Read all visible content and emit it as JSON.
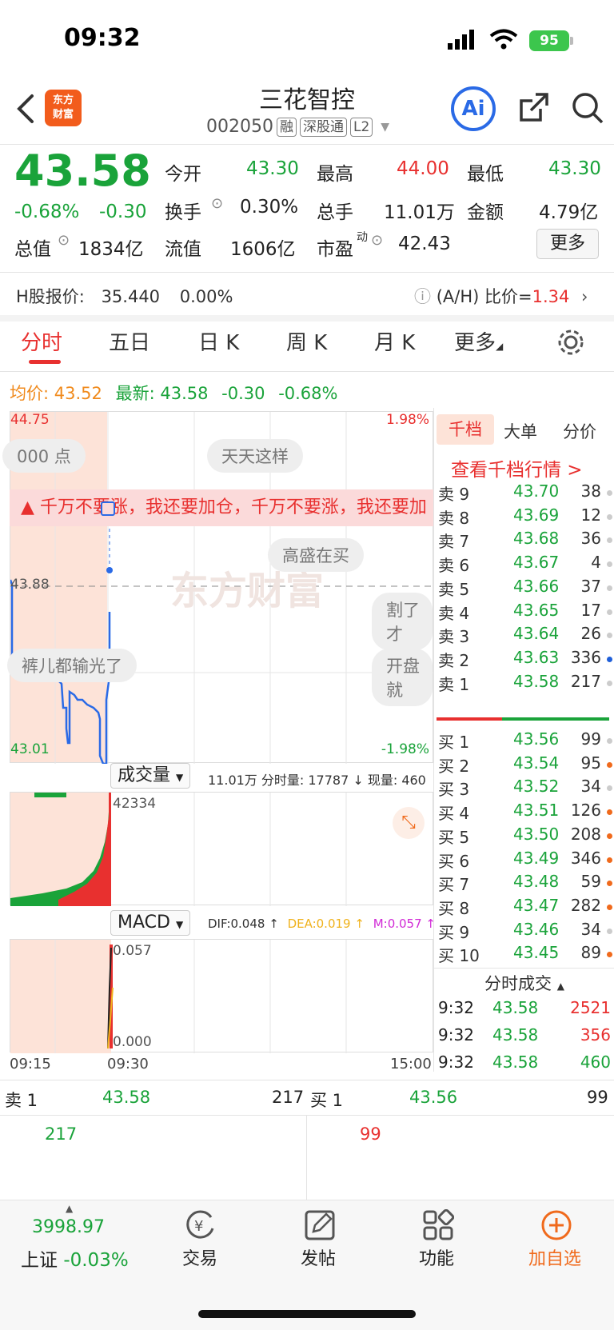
{
  "status": {
    "time": "09:32",
    "battery": "95"
  },
  "header": {
    "logo_text": "东方财富",
    "title": "三花智控",
    "code": "002050",
    "tags": [
      "融",
      "深股通",
      "L2"
    ],
    "ai_label": "Ai"
  },
  "quote": {
    "price": "43.58",
    "change_pct": "-0.68%",
    "change": "-0.30",
    "open_label": "今开",
    "open": "43.30",
    "high_label": "最高",
    "high": "44.00",
    "low_label": "最低",
    "low": "43.30",
    "turnover_label": "换手",
    "turnover": "0.30%",
    "volume_label": "总手",
    "volume": "11.01万",
    "amount_label": "金额",
    "amount": "4.79亿",
    "mcap_label": "总值",
    "mcap": "1834亿",
    "float_label": "流值",
    "float": "1606亿",
    "pe_label": "市盈",
    "pe_sup": "动",
    "pe": "42.43",
    "more_label": "更多"
  },
  "hshare": {
    "label": "H股报价:",
    "price": "35.440",
    "change": "0.00%",
    "ratio_label": "(A/H) 比价=",
    "ratio": "1.34"
  },
  "tabs": [
    "分时",
    "五日",
    "日 K",
    "周 K",
    "月 K",
    "更多"
  ],
  "legend": {
    "avg_label": "均价:",
    "avg": "43.52",
    "last_label": "最新:",
    "last": "43.58",
    "chg": "-0.30",
    "chg_pct": "-0.68%"
  },
  "chart": {
    "y_high": "44.75",
    "y_low": "43.01",
    "y_mid": "43.88",
    "pct_high": "1.98%",
    "pct_low": "-1.98%",
    "bullets": [
      "000 点",
      "天天这样",
      "高盛在买",
      "割了才",
      "裤儿都输光了",
      "开盘就"
    ],
    "danmu": "千万不要涨，我还要加仓，千万不要涨，我还要加",
    "watermark": "东方财富",
    "vol_label": "成交量",
    "vol_info": "11.01万 分时量: 17787 ↓ 现量: 460",
    "vol_max": "42334",
    "macd_label": "MACD",
    "dif": "DIF:0.048 ↑",
    "dea": "DEA:0.019 ↑",
    "m": "M:0.057 ↑",
    "macd_max": "0.057",
    "macd_zero": "0.000",
    "t_start": "09:15",
    "t_mid": "09:30",
    "t_end": "15:00"
  },
  "orderbook": {
    "tabs": [
      "千档",
      "大单",
      "分价"
    ],
    "link": "查看千档行情 >",
    "sells": [
      {
        "label": "卖 9",
        "price": "43.70",
        "vol": "38",
        "dot": "#ccc"
      },
      {
        "label": "卖 8",
        "price": "43.69",
        "vol": "12",
        "dot": "#ccc"
      },
      {
        "label": "卖 7",
        "price": "43.68",
        "vol": "36",
        "dot": "#ccc"
      },
      {
        "label": "卖 6",
        "price": "43.67",
        "vol": "4",
        "dot": "#ccc"
      },
      {
        "label": "卖 5",
        "price": "43.66",
        "vol": "37",
        "dot": "#ccc"
      },
      {
        "label": "卖 4",
        "price": "43.65",
        "vol": "17",
        "dot": "#ccc"
      },
      {
        "label": "卖 3",
        "price": "43.64",
        "vol": "26",
        "dot": "#ccc"
      },
      {
        "label": "卖 2",
        "price": "43.63",
        "vol": "336",
        "dot": "#1f5fd9"
      },
      {
        "label": "卖 1",
        "price": "43.58",
        "vol": "217",
        "dot": "#ccc"
      }
    ],
    "buys": [
      {
        "label": "买 1",
        "price": "43.56",
        "vol": "99",
        "dot": "#ccc"
      },
      {
        "label": "买 2",
        "price": "43.54",
        "vol": "95",
        "dot": "#f06a1c"
      },
      {
        "label": "买 3",
        "price": "43.52",
        "vol": "34",
        "dot": "#ccc"
      },
      {
        "label": "买 4",
        "price": "43.51",
        "vol": "126",
        "dot": "#f06a1c"
      },
      {
        "label": "买 5",
        "price": "43.50",
        "vol": "208",
        "dot": "#f06a1c"
      },
      {
        "label": "买 6",
        "price": "43.49",
        "vol": "346",
        "dot": "#f06a1c"
      },
      {
        "label": "买 7",
        "price": "43.48",
        "vol": "59",
        "dot": "#f06a1c"
      },
      {
        "label": "买 8",
        "price": "43.47",
        "vol": "282",
        "dot": "#f06a1c"
      },
      {
        "label": "买 9",
        "price": "43.46",
        "vol": "34",
        "dot": "#ccc"
      },
      {
        "label": "买 10",
        "price": "43.45",
        "vol": "89",
        "dot": "#f06a1c"
      }
    ],
    "trades_label": "分时成交",
    "trades": [
      {
        "time": "9:32",
        "price": "43.58",
        "vol": "2521"
      },
      {
        "time": "9:32",
        "price": "43.58",
        "vol": "356"
      },
      {
        "time": "9:32",
        "price": "43.58",
        "vol": "460"
      }
    ]
  },
  "bottom_quote": {
    "sell_label": "卖 1",
    "sell_price": "43.58",
    "sell_vol": "217",
    "buy_label": "买 1",
    "buy_price": "43.56",
    "buy_vol": "99",
    "sell_qty": "217",
    "buy_qty": "99"
  },
  "bottom_nav": {
    "index_value": "3998.97",
    "index_name": "上证",
    "index_chg": "-0.03%",
    "items": [
      "交易",
      "发帖",
      "功能",
      "加自选"
    ]
  }
}
